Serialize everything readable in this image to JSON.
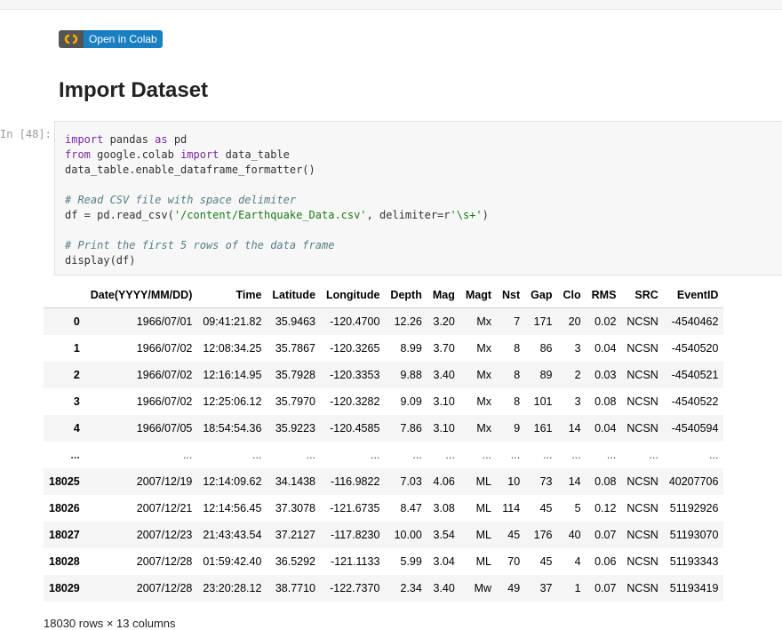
{
  "badge": {
    "label": "Open in Colab",
    "icon": "colab-logo-icon"
  },
  "heading": "Import Dataset",
  "cell": {
    "prompt": "In [48]:",
    "lines": [
      [
        {
          "t": "import",
          "c": "kw"
        },
        {
          "t": " pandas "
        },
        {
          "t": "as",
          "c": "kw"
        },
        {
          "t": " pd"
        }
      ],
      [
        {
          "t": "from",
          "c": "kw"
        },
        {
          "t": " google.colab "
        },
        {
          "t": "import",
          "c": "kw"
        },
        {
          "t": " data_table"
        }
      ],
      [
        {
          "t": "data_table.enable_dataframe_formatter()"
        }
      ],
      [],
      [
        {
          "t": "# Read CSV file with space delimiter",
          "c": "cm"
        }
      ],
      [
        {
          "t": "df = pd.read_csv("
        },
        {
          "t": "'/content/Earthquake_Data.csv'",
          "c": "st"
        },
        {
          "t": ", delimiter=r"
        },
        {
          "t": "'\\s+'",
          "c": "st"
        },
        {
          "t": ")"
        }
      ],
      [],
      [
        {
          "t": "# Print the first 5 rows of the data frame",
          "c": "cm"
        }
      ],
      [
        {
          "t": "display(df)"
        }
      ]
    ]
  },
  "table": {
    "columns": [
      "",
      "Date(YYYY/MM/DD)",
      "Time",
      "Latitude",
      "Longitude",
      "Depth",
      "Mag",
      "Magt",
      "Nst",
      "Gap",
      "Clo",
      "RMS",
      "SRC",
      "EventID"
    ],
    "rows": [
      [
        "0",
        "1966/07/01",
        "09:41:21.82",
        "35.9463",
        "-120.4700",
        "12.26",
        "3.20",
        "Mx",
        "7",
        "171",
        "20",
        "0.02",
        "NCSN",
        "-4540462"
      ],
      [
        "1",
        "1966/07/02",
        "12:08:34.25",
        "35.7867",
        "-120.3265",
        "8.99",
        "3.70",
        "Mx",
        "8",
        "86",
        "3",
        "0.04",
        "NCSN",
        "-4540520"
      ],
      [
        "2",
        "1966/07/02",
        "12:16:14.95",
        "35.7928",
        "-120.3353",
        "9.88",
        "3.40",
        "Mx",
        "8",
        "89",
        "2",
        "0.03",
        "NCSN",
        "-4540521"
      ],
      [
        "3",
        "1966/07/02",
        "12:25:06.12",
        "35.7970",
        "-120.3282",
        "9.09",
        "3.10",
        "Mx",
        "8",
        "101",
        "3",
        "0.08",
        "NCSN",
        "-4540522"
      ],
      [
        "4",
        "1966/07/05",
        "18:54:54.36",
        "35.9223",
        "-120.4585",
        "7.86",
        "3.10",
        "Mx",
        "9",
        "161",
        "14",
        "0.04",
        "NCSN",
        "-4540594"
      ],
      [
        "...",
        "...",
        "...",
        "...",
        "...",
        "...",
        "...",
        "...",
        "...",
        "...",
        "...",
        "...",
        "...",
        "..."
      ],
      [
        "18025",
        "2007/12/19",
        "12:14:09.62",
        "34.1438",
        "-116.9822",
        "7.03",
        "4.06",
        "ML",
        "10",
        "73",
        "14",
        "0.08",
        "NCSN",
        "40207706"
      ],
      [
        "18026",
        "2007/12/21",
        "12:14:56.45",
        "37.3078",
        "-121.6735",
        "8.47",
        "3.08",
        "ML",
        "114",
        "45",
        "5",
        "0.12",
        "NCSN",
        "51192926"
      ],
      [
        "18027",
        "2007/12/23",
        "21:43:43.54",
        "37.2127",
        "-117.8230",
        "10.00",
        "3.54",
        "ML",
        "45",
        "176",
        "40",
        "0.07",
        "NCSN",
        "51193070"
      ],
      [
        "18028",
        "2007/12/28",
        "01:59:42.40",
        "36.5292",
        "-121.1133",
        "5.99",
        "3.04",
        "ML",
        "70",
        "45",
        "4",
        "0.06",
        "NCSN",
        "51193343"
      ],
      [
        "18029",
        "2007/12/28",
        "23:20:28.12",
        "38.7710",
        "-122.7370",
        "2.34",
        "3.40",
        "Mw",
        "49",
        "37",
        "1",
        "0.07",
        "NCSN",
        "51193419"
      ]
    ]
  },
  "summary": "18030 rows × 13 columns"
}
